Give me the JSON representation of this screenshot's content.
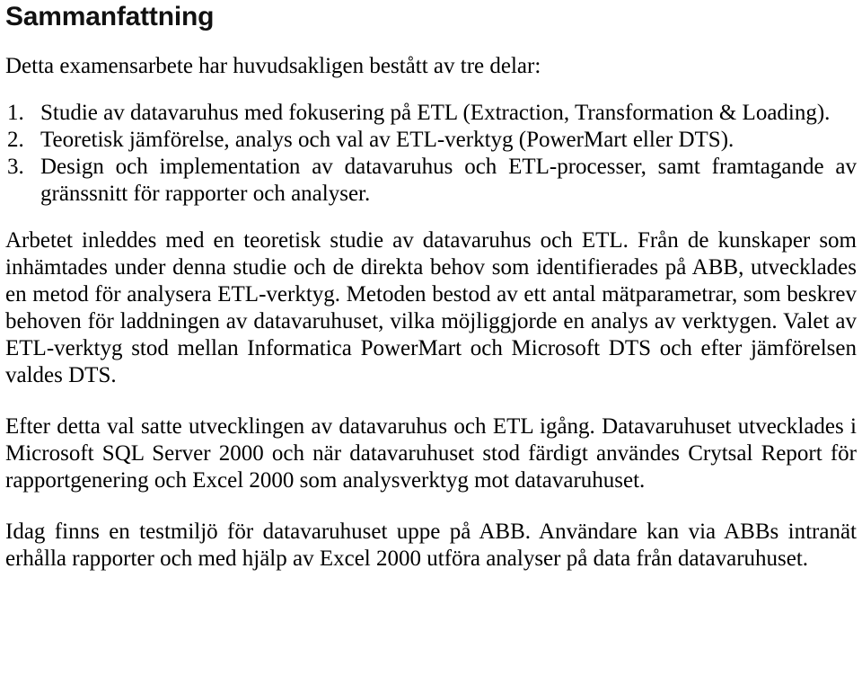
{
  "document": {
    "language": "sv",
    "title": "Sammanfattning",
    "intro": "Detta examensarbete har huvudsakligen bestått av tre delar:",
    "list": {
      "markers": [
        "1.",
        "2.",
        "3."
      ],
      "items": [
        "Studie av datavaruhus med fokusering på ETL (Extraction, Transformation & Loading).",
        "Teoretisk jämförelse, analys och val av ETL-verktyg (PowerMart eller DTS).",
        "Design och implementation av datavaruhus och ETL-processer, samt framtagande av gränssnitt för rapporter och analyser."
      ]
    },
    "paragraphs": [
      "Arbetet inleddes med en teoretisk studie av datavaruhus och ETL. Från de kunskaper som inhämtades under denna studie och de direkta behov som identifierades på ABB, utvecklades en metod för analysera ETL-verktyg. Metoden bestod av ett antal mätparametrar, som beskrev behoven för laddningen av datavaruhuset, vilka möjliggjorde en analys av verktygen. Valet av ETL-verktyg stod mellan Informatica PowerMart och Microsoft DTS och efter jämförelsen valdes DTS.",
      "Efter detta val satte utvecklingen av datavaruhus och ETL igång. Datavaruhuset utvecklades i Microsoft SQL Server 2000 och när datavaruhuset stod färdigt användes Crytsal Report för rapportgenering och Excel 2000 som analysverktyg mot datavaruhuset.",
      "Idag finns en testmiljö för datavaruhuset uppe på ABB. Användare kan via ABBs intranät erhålla rapporter och med hjälp av Excel 2000 utföra analyser på data från datavaruhuset."
    ],
    "colors": {
      "text": "#000000",
      "background": "#ffffff",
      "heading": "#111111"
    }
  }
}
